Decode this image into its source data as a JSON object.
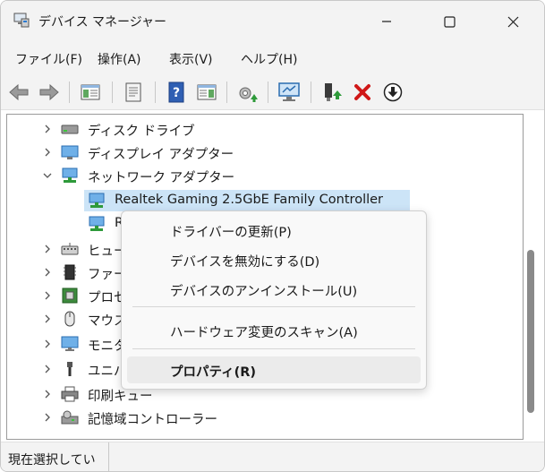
{
  "window": {
    "title": "デバイス マネージャー"
  },
  "menu": [
    "ファイル(F)",
    "操作(A)",
    "表示(V)",
    "ヘルプ(H)"
  ],
  "tree": {
    "rows": [
      {
        "label": "ディスク ドライブ",
        "icon": "disk-drive-icon",
        "expanded": false
      },
      {
        "label": "ディスプレイ アダプター",
        "icon": "display-adapter-icon",
        "expanded": false
      },
      {
        "label": "ネットワーク アダプター",
        "icon": "network-adapter-icon",
        "expanded": true
      },
      {
        "label": "Realtek Gaming 2.5GbE Family Controller",
        "icon": "network-card-icon",
        "child": true,
        "selected": true
      },
      {
        "label": "R",
        "icon": "network-card-icon",
        "child": true
      },
      {
        "label": "ヒュー",
        "icon": "hid-icon",
        "expanded": false
      },
      {
        "label": "ファー",
        "icon": "firmware-icon",
        "expanded": false
      },
      {
        "label": "プロセ",
        "icon": "processor-icon",
        "expanded": false
      },
      {
        "label": "マウス",
        "icon": "mouse-icon",
        "expanded": false
      },
      {
        "label": "モニタ",
        "icon": "monitor-icon",
        "expanded": false
      },
      {
        "label": "ユニバ",
        "icon": "usb-icon",
        "expanded": false
      },
      {
        "label": "印刷キュー",
        "icon": "printer-icon",
        "expanded": false
      },
      {
        "label": "記憶域コントローラー",
        "icon": "storage-controller-icon",
        "expanded": false
      }
    ]
  },
  "context_menu": {
    "items": [
      {
        "label": "ドライバーの更新(P)"
      },
      {
        "label": "デバイスを無効にする(D)"
      },
      {
        "label": "デバイスのアンインストール(U)"
      },
      {
        "label": "ハードウェア変更のスキャン(A)"
      },
      {
        "label": "プロパティ(R)",
        "bold": true,
        "hovered": true
      }
    ]
  },
  "status": {
    "text": "現在選択してい"
  },
  "colors": {
    "selection": "#cce4f7",
    "accent": "#0a64c8",
    "danger": "#d01818"
  }
}
